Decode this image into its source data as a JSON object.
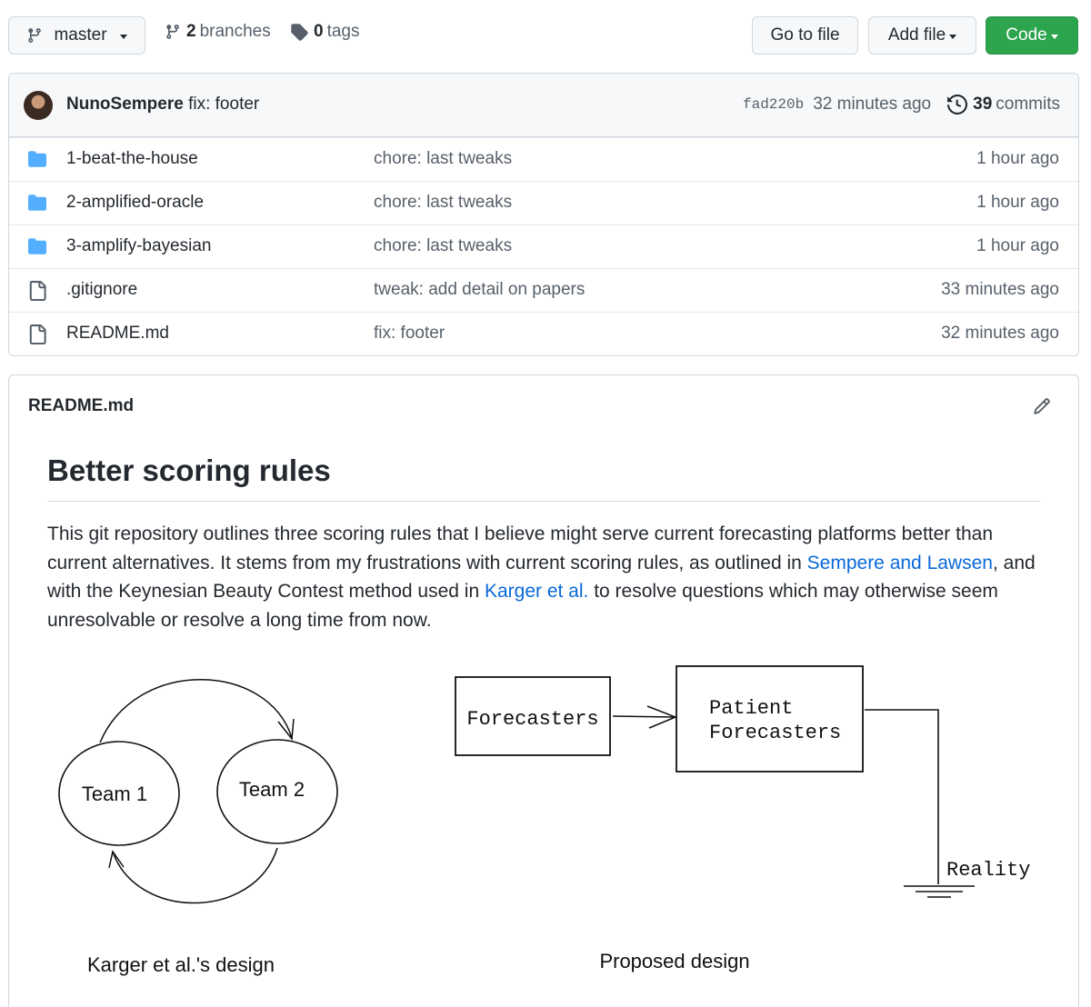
{
  "toolbar": {
    "branch_button": "master",
    "branches_count": "2",
    "branches_label": "branches",
    "tags_count": "0",
    "tags_label": "tags",
    "go_to_file": "Go to file",
    "add_file": "Add file",
    "code": "Code"
  },
  "commit": {
    "author": "NunoSempere",
    "message": "fix: footer",
    "sha": "fad220b",
    "time": "32 minutes ago",
    "commits_count": "39",
    "commits_label": "commits"
  },
  "files": [
    {
      "type": "folder",
      "name": "1-beat-the-house",
      "message": "chore: last tweaks",
      "age": "1 hour ago"
    },
    {
      "type": "folder",
      "name": "2-amplified-oracle",
      "message": "chore: last tweaks",
      "age": "1 hour ago"
    },
    {
      "type": "folder",
      "name": "3-amplify-bayesian",
      "message": "chore: last tweaks",
      "age": "1 hour ago"
    },
    {
      "type": "file",
      "name": ".gitignore",
      "message": "tweak: add detail on papers",
      "age": "33 minutes ago"
    },
    {
      "type": "file",
      "name": "README.md",
      "message": "fix: footer",
      "age": "32 minutes ago"
    }
  ],
  "readme": {
    "filename": "README.md",
    "title": "Better scoring rules",
    "para_1": "This git repository outlines three scoring rules that I believe might serve current forecasting platforms better than current alternatives. It stems from my frustrations with current scoring rules, as outlined in ",
    "link_1": "Sempere and Lawsen",
    "para_2": ", and with the Keynesian Beauty Contest method used in ",
    "link_2": "Karger et al.",
    "para_3": " to resolve questions which may otherwise seem unresolvable or resolve a long time from now."
  },
  "diagram": {
    "team_1": "Team 1",
    "team_2": "Team 2",
    "left_caption": "Karger et al.'s design",
    "forecasters": "Forecasters",
    "patient_line_1": "Patient",
    "patient_line_2": "Forecasters",
    "reality": "Reality",
    "right_caption": "Proposed design"
  },
  "colors": {
    "accent_green": "#2da44e",
    "link_blue": "#0969da",
    "folder_blue": "#54aeff"
  }
}
